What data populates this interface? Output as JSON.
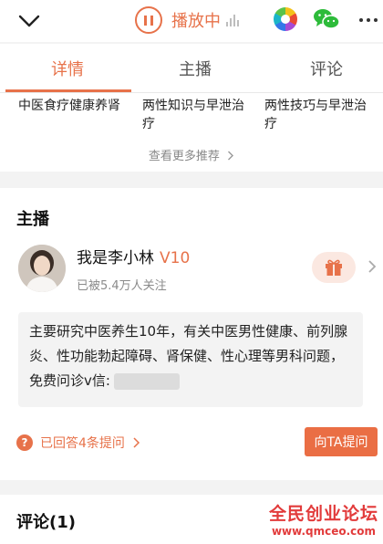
{
  "header": {
    "play_status": "播放中",
    "icons": [
      "chevron-down-icon",
      "pause-icon",
      "equalizer-icon",
      "color-wheel-icon",
      "wechat-icon",
      "more-icon"
    ]
  },
  "tabs": [
    {
      "label": "详情",
      "active": true
    },
    {
      "label": "主播",
      "active": false
    },
    {
      "label": "评论",
      "active": false
    }
  ],
  "recommendations": {
    "items": [
      "中医食疗健康养肾",
      "两性知识与早泄治疗",
      "两性技巧与早泄治疗"
    ],
    "see_more": "查看更多推荐"
  },
  "host": {
    "section_title": "主播",
    "name": "我是李小林",
    "level": "V10",
    "followers": "已被5.4万人关注",
    "intro": "主要研究中医养生10年，有关中医男性健康、前列腺炎、性功能勃起障碍、肾保健、性心理等男科问题，免费问诊v信:",
    "answered": "已回答4条提问",
    "ask_button": "向TA提问"
  },
  "comments": {
    "section_title": "评论(1)"
  },
  "watermark": {
    "title": "全民创业论坛",
    "url": "www.qmceo.com"
  },
  "colors": {
    "accent": "#e7724a",
    "button": "#ea6e44",
    "watermark": "#e23b3b",
    "background": "#f3f3f3"
  }
}
